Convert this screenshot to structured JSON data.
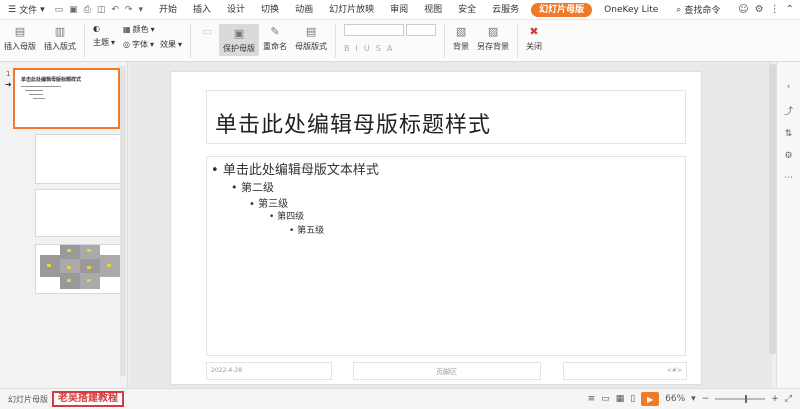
{
  "menubar": {
    "file": "文件",
    "tabs": [
      "开始",
      "插入",
      "设计",
      "切换",
      "动画",
      "幻灯片放映",
      "审阅",
      "视图",
      "安全",
      "云服务",
      "幻灯片母版",
      "OneKey Lite"
    ],
    "active_tab": "幻灯片母版",
    "search": "查找命令"
  },
  "ribbon": {
    "insert_master": "插入母版",
    "insert_layout": "插入版式",
    "theme": "主题",
    "colors": "颜色",
    "fonts": "字体",
    "effects": "效果",
    "protect_master": "保护母版",
    "rename": "重命名",
    "master_layout": "母版版式",
    "background": "背景",
    "save_background": "另存背景",
    "close": "关闭"
  },
  "slide": {
    "title": "单击此处编辑母版标题样式",
    "body_levels": [
      "单击此处编辑母版文本样式",
      "第二级",
      "第三级",
      "第四级",
      "第五级"
    ],
    "date": "2022-4-28",
    "footer": "页脚区",
    "slide_number": "<#>"
  },
  "thumbnails": {
    "first_number": "1",
    "first_title": "单击此处编辑母版标题样式"
  },
  "status": {
    "view_label": "幻灯片母版",
    "brand": "老吴搭建教程",
    "zoom": "66%"
  },
  "colors": {
    "accent": "#f07a28",
    "brand_red": "#d23c3c"
  }
}
